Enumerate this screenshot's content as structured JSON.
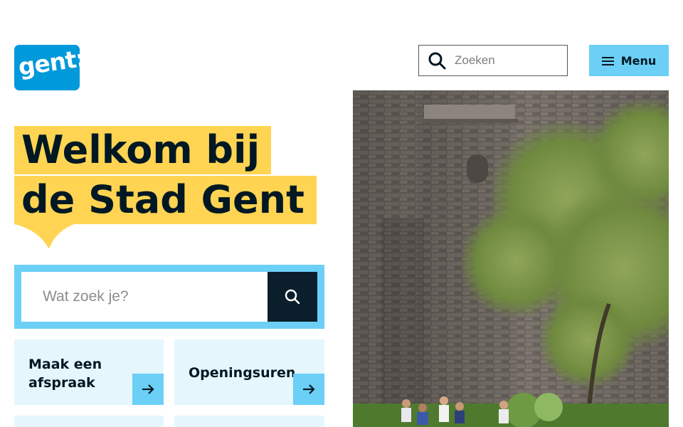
{
  "header": {
    "logo_text": "gent:",
    "search_placeholder": "Zoeken",
    "menu_label": "Menu"
  },
  "hero": {
    "title_line1": "Welkom bij",
    "title_line2": "de Stad Gent"
  },
  "main_search": {
    "placeholder": "Wat zoek je?"
  },
  "tiles": [
    {
      "line1": "Maak een",
      "line2": "afspraak"
    },
    {
      "label": "Openingsuren"
    }
  ],
  "colors": {
    "brand_blue": "#0099da",
    "accent_light_blue": "#6ccff6",
    "tile_bg": "#e5f6fd",
    "highlight_yellow": "#ffd452",
    "dark_navy": "#0b1e2b"
  },
  "icons": {
    "top_search": "search-icon",
    "menu": "hamburger-icon",
    "main_search": "search-icon",
    "tile_arrow": "arrow-right-icon"
  }
}
